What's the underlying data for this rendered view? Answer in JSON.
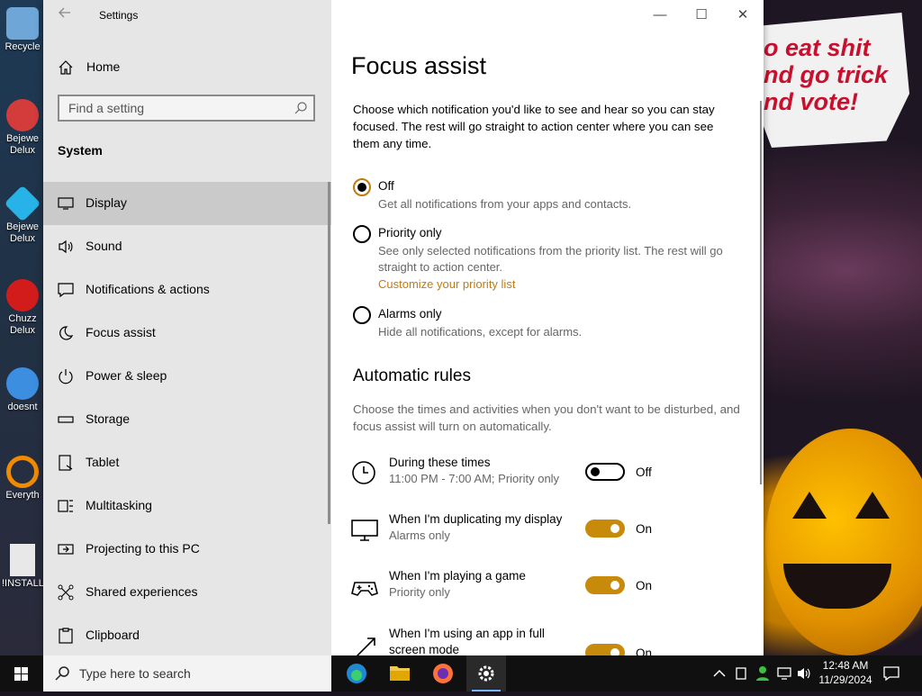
{
  "desktop": {
    "icons": [
      {
        "label": "Recycle",
        "color": "#6ea6d8"
      },
      {
        "label": "Bejewe Delux",
        "color": "#d43b3b"
      },
      {
        "label": "Bejewe Delux",
        "color": "#27b3e8"
      },
      {
        "label": "Chuzz Delux",
        "color": "#d21c1c"
      },
      {
        "label": "doesnt",
        "color": "#3b8ee0"
      },
      {
        "label": "Everyth",
        "color": "#f08a00"
      },
      {
        "label": "!INSTALL",
        "color": "#e8e8e8"
      }
    ],
    "banner_lines": [
      "o eat shit",
      "nd go trick",
      "nd vote!"
    ]
  },
  "window": {
    "app_title": "Settings",
    "controls": {
      "minimize": "—",
      "maximize": "☐",
      "close": "✕"
    }
  },
  "sidebar": {
    "home_label": "Home",
    "search_placeholder": "Find a setting",
    "section_title": "System",
    "items": [
      {
        "label": "Display",
        "icon": "display-icon",
        "selected": true
      },
      {
        "label": "Sound",
        "icon": "speaker-icon"
      },
      {
        "label": "Notifications & actions",
        "icon": "notification-icon"
      },
      {
        "label": "Focus assist",
        "icon": "moon-icon"
      },
      {
        "label": "Power & sleep",
        "icon": "power-icon"
      },
      {
        "label": "Storage",
        "icon": "storage-icon"
      },
      {
        "label": "Tablet",
        "icon": "tablet-icon"
      },
      {
        "label": "Multitasking",
        "icon": "multitasking-icon"
      },
      {
        "label": "Projecting to this PC",
        "icon": "projecting-icon"
      },
      {
        "label": "Shared experiences",
        "icon": "shared-icon"
      },
      {
        "label": "Clipboard",
        "icon": "clipboard-icon"
      }
    ]
  },
  "main": {
    "title": "Focus assist",
    "description": "Choose which notification you'd like to see and hear so you can stay focused. The rest will go straight to action center where you can see them any time.",
    "options": [
      {
        "label": "Off",
        "description": "Get all notifications from your apps and contacts.",
        "checked": true
      },
      {
        "label": "Priority only",
        "description": "See only selected notifications from the priority list. The rest will go straight to action center.",
        "link": "Customize your priority list",
        "checked": false
      },
      {
        "label": "Alarms only",
        "description": "Hide all notifications, except for alarms.",
        "checked": false
      }
    ],
    "automatic_rules": {
      "heading": "Automatic rules",
      "description": "Choose the times and activities when you don't want to be disturbed, and focus assist will turn on automatically.",
      "rules": [
        {
          "title": "During these times",
          "subtitle": "11:00 PM - 7:00 AM; Priority only",
          "state": "Off",
          "on": false,
          "icon": "clock-icon"
        },
        {
          "title": "When I'm duplicating my display",
          "subtitle": "Alarms only",
          "state": "On",
          "on": true,
          "icon": "monitor-icon"
        },
        {
          "title": "When I'm playing a game",
          "subtitle": "Priority only",
          "state": "On",
          "on": true,
          "icon": "gamepad-icon"
        },
        {
          "title": "When I'm using an app in full screen mode",
          "subtitle": "",
          "state": "On",
          "on": true,
          "icon": "fullscreen-icon"
        }
      ]
    }
  },
  "taskbar": {
    "search_text": "Type here to search",
    "clock_time": "12:48 AM",
    "clock_date": "11/29/2024",
    "accent": "#c27c0e"
  }
}
